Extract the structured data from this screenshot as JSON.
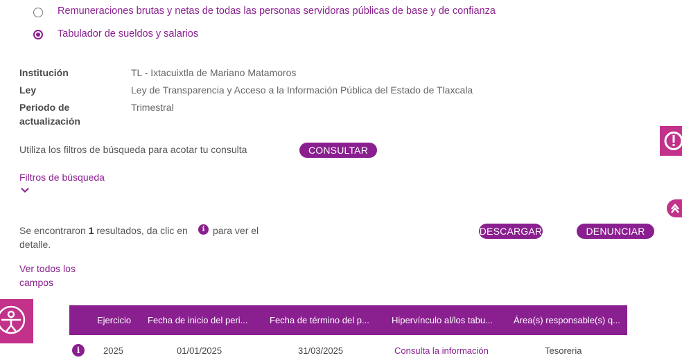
{
  "options": [
    {
      "label": "Remuneraciones brutas y netas de todas las personas servidoras públicas de base y de confianza",
      "checked": false
    },
    {
      "label": "Tabulador de sueldos y salarios",
      "checked": true
    }
  ],
  "meta": {
    "institucion_key": "Institución",
    "institucion_val": "TL - Ixtacuixtla de Mariano Matamoros",
    "ley_key": "Ley",
    "ley_val": "Ley de Transparencia y Acceso a la Información Pública del Estado de Tlaxcala",
    "periodo_key_1": "Periodo de",
    "periodo_key_2": "actualización",
    "periodo_val": "Trimestral"
  },
  "search": {
    "hint": "Utiliza los filtros de búsqueda para acotar tu consulta",
    "consult_label": "CONSULTAR",
    "filters_label": "Filtros de búsqueda"
  },
  "results": {
    "prefix": "Se encontraron",
    "count": "1",
    "middle": "resultados, da clic en",
    "suffix": "para ver el",
    "suffix2": "detalle.",
    "download_label": "DESCARGAR",
    "report_label": "DENUNCIAR",
    "all_fields_1": "Ver todos los",
    "all_fields_2": "campos"
  },
  "table": {
    "headers": [
      "Ejercicio",
      "Fecha de inicio del peri...",
      "Fecha de término del p...",
      "Hipervínculo al/los tabu...",
      "Área(s) responsable(s) q..."
    ],
    "rows": [
      {
        "ejercicio": "2025",
        "inicio": "01/01/2025",
        "termino": "31/03/2025",
        "hipervinculo": "Consulta la información",
        "area": "Tesoreria"
      }
    ]
  },
  "colors": {
    "accent": "#8a1f8f",
    "side": "#c2318a"
  },
  "icons": [
    "radio-unchecked-icon",
    "radio-checked-icon",
    "chevron-down-icon",
    "info-icon",
    "alert-icon",
    "scroll-up-icon",
    "accessibility-icon"
  ]
}
